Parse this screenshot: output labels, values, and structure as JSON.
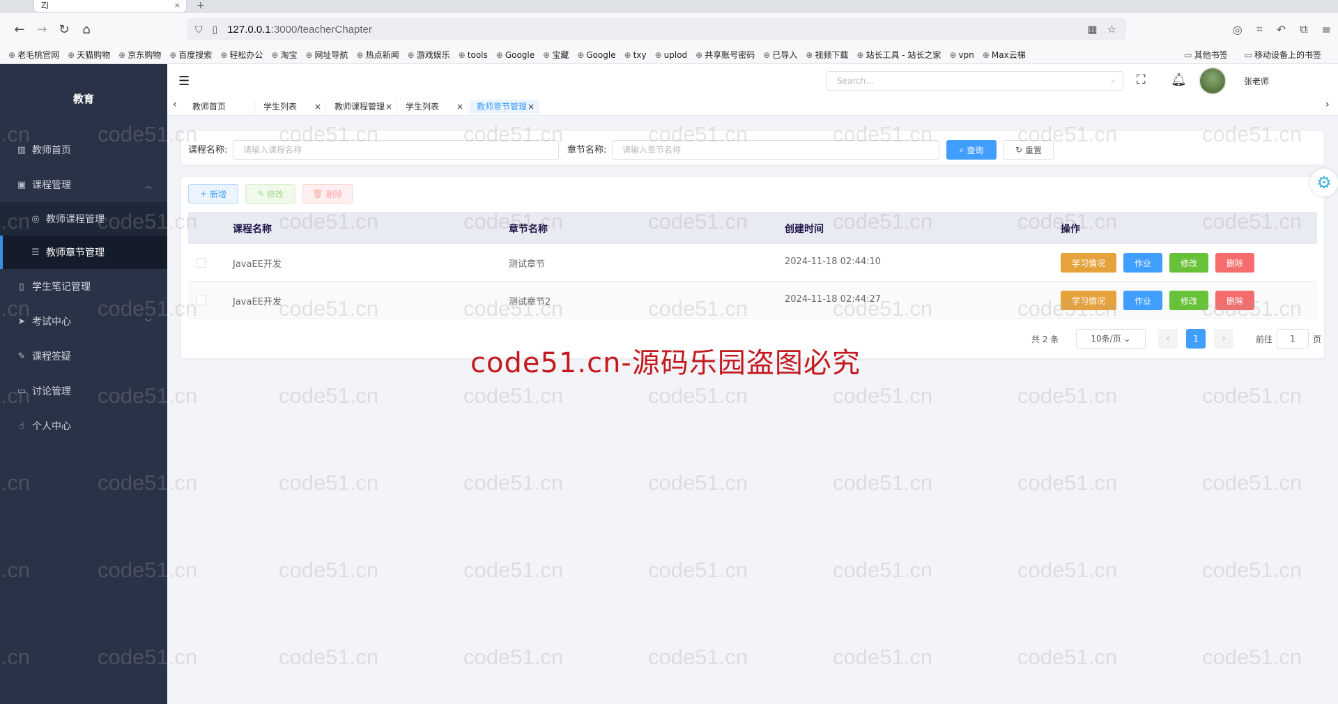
{
  "browser": {
    "tab_title": "ZJ",
    "url_host": "127.0.0.1",
    "url_path": ":3000/teacherChapter",
    "bookmarks": [
      "老毛桃官网",
      "天猫购物",
      "京东购物",
      "百度搜索",
      "轻松办公",
      "淘宝",
      "网址导航",
      "热点新闻",
      "游戏娱乐",
      "tools",
      "Google",
      "宝藏",
      "Google",
      "txy",
      "uplod",
      "共享账号密码",
      "已导入",
      "视频下载",
      "站长工具 - 站长之家",
      "vpn",
      "Max云梯"
    ],
    "bookmarks_right": [
      "其他书签",
      "移动设备上的书签"
    ]
  },
  "sidebar": {
    "title": "教育",
    "items": [
      {
        "label": "教师首页",
        "icon": "chart-icon"
      },
      {
        "label": "课程管理",
        "icon": "clipboard-icon",
        "expanded": true
      },
      {
        "label": "教师课程管理",
        "icon": "circle-icon",
        "sub": true
      },
      {
        "label": "教师章节管理",
        "icon": "sliders-icon",
        "sub": true,
        "active": true
      },
      {
        "label": "学生笔记管理",
        "icon": "document-icon"
      },
      {
        "label": "考试中心",
        "icon": "send-icon",
        "collapsed": true
      },
      {
        "label": "课程答疑",
        "icon": "edit-icon"
      },
      {
        "label": "讨论管理",
        "icon": "book-icon"
      },
      {
        "label": "个人中心",
        "icon": "hand-icon"
      }
    ]
  },
  "topnav": {
    "search_placeholder": "Search...",
    "username": "张老师"
  },
  "tags": [
    "教师首页",
    "学生列表",
    "教师课程管理",
    "学生列表",
    "教师章节管理"
  ],
  "filter": {
    "course_label": "课程名称:",
    "course_placeholder": "请输入课程名称",
    "chapter_label": "章节名称:",
    "chapter_placeholder": "请输入章节名称",
    "query": "查询",
    "reset": "重置"
  },
  "actions": {
    "add": "新增",
    "edit": "修改",
    "delete": "删除"
  },
  "table": {
    "headers": [
      "课程名称",
      "章节名称",
      "创建时间",
      "操作"
    ],
    "rows": [
      {
        "course": "JavaEE开发",
        "chapter": "测试章节",
        "created": "2024-11-18 02:44:10"
      },
      {
        "course": "JavaEE开发",
        "chapter": "测试章节2",
        "created": "2024-11-18 02:44:27"
      }
    ],
    "row_actions": {
      "study": "学习情况",
      "work": "作业",
      "edit": "修改",
      "delete": "删除"
    }
  },
  "pagination": {
    "total_text": "共 2 条",
    "page_size": "10条/页",
    "current_page": "1",
    "goto_label": "前往",
    "goto_value": "1",
    "page_unit": "页"
  },
  "watermark": {
    "text": "code51.cn",
    "banner": "code51.cn-源码乐园盗图必究"
  },
  "colors": {
    "sidebar_bg": "#293246",
    "primary": "#409eff",
    "warning": "#e6a23c",
    "success": "#67c23a",
    "danger": "#f56c6c",
    "banner_red": "#c4191f"
  }
}
